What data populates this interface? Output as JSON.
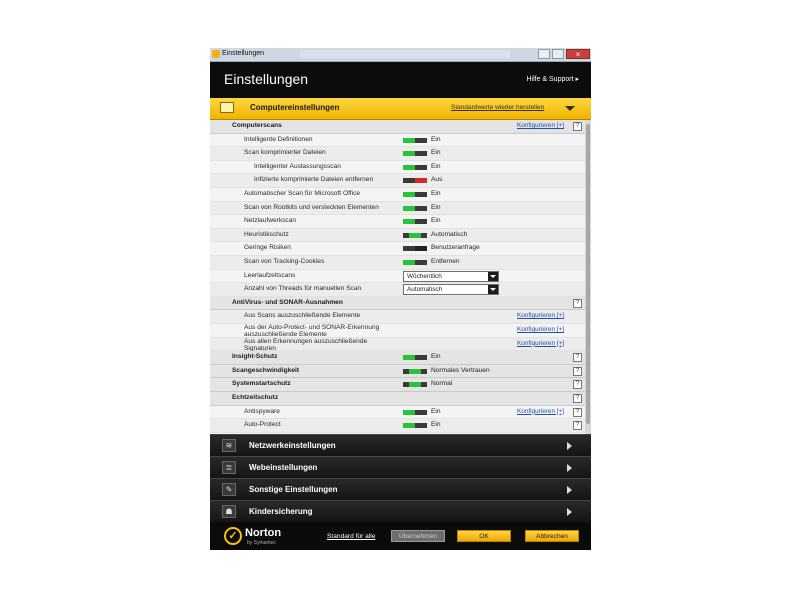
{
  "window": {
    "title": "Einstellungen",
    "header_title": "Einstellungen",
    "help_link": "Hilfe & Support ▸"
  },
  "category": {
    "title": "Computereinstellungen",
    "reset_link": "Standardwerte wieder herstellen"
  },
  "rows": [
    {
      "type": "section",
      "label": "Computerscans",
      "indent": 22,
      "cfg": "Konfigurieren [+]",
      "help": "?"
    },
    {
      "type": "toggle",
      "label": "Intelligente Definitionen",
      "indent": 34,
      "state": "on",
      "value": "Ein"
    },
    {
      "type": "toggle",
      "label": "Scan komprimierter Dateien",
      "indent": 34,
      "state": "on",
      "value": "Ein"
    },
    {
      "type": "toggle",
      "label": "Intelligenter Auslassungsscan",
      "indent": 44,
      "state": "on",
      "value": "Ein"
    },
    {
      "type": "toggle",
      "label": "Infizierte komprimierte Dateien entfernen",
      "indent": 44,
      "state": "off",
      "value": "Aus"
    },
    {
      "type": "toggle",
      "label": "Automatischer Scan für Microsoft Office",
      "indent": 34,
      "state": "on",
      "value": "Ein"
    },
    {
      "type": "toggle",
      "label": "Scan von Rootkits und versteckten Elementen",
      "indent": 34,
      "state": "on",
      "value": "Ein"
    },
    {
      "type": "toggle",
      "label": "Netzlaufwerkscan",
      "indent": 34,
      "state": "on",
      "value": "Ein"
    },
    {
      "type": "toggle",
      "label": "Heuristikschutz",
      "indent": 34,
      "state": "mid",
      "value": "Automatisch"
    },
    {
      "type": "toggle",
      "label": "Geringe Risiken",
      "indent": 34,
      "state": "dark",
      "value": "Benutzeranfrage"
    },
    {
      "type": "toggle",
      "label": "Scan von Tracking-Cookies",
      "indent": 34,
      "state": "on",
      "value": "Entfernen"
    },
    {
      "type": "select",
      "label": "Leerlaufzeitscans",
      "indent": 34,
      "value": "Wöchentlich"
    },
    {
      "type": "select",
      "label": "Anzahl von Threads für manuellen Scan",
      "indent": 34,
      "value": "Automatisch"
    },
    {
      "type": "section",
      "label": "AntiVirus- und SONAR-Ausnahmen",
      "indent": 22,
      "help": "?"
    },
    {
      "type": "link",
      "label": "Aus Scans auszuschließende Elemente",
      "indent": 34,
      "cfg": "Konfigurieren [+]"
    },
    {
      "type": "link2",
      "label": "Aus der Auto-Protect- und SONAR-Erkennung",
      "label2": "auszuschließende Elemente",
      "indent": 34,
      "cfg": "Konfigurieren [+]"
    },
    {
      "type": "link2",
      "label": "Aus allen Erkennungen auszuschließende",
      "label2": "Signaturen",
      "indent": 34,
      "cfg": "Konfigurieren [+]"
    },
    {
      "type": "section",
      "label": "Insight-Schutz",
      "indent": 22,
      "state": "on",
      "value": "Ein",
      "help": "?"
    },
    {
      "type": "section",
      "label": "Scangeschwindigkeit",
      "indent": 22,
      "state": "mid",
      "value": "Normales Vertrauen",
      "help": "?"
    },
    {
      "type": "section",
      "label": "Systemstartschutz",
      "indent": 22,
      "state": "mid",
      "value": "Normal",
      "help": "?"
    },
    {
      "type": "section",
      "label": "Echtzeitschutz",
      "indent": 22,
      "help": "?"
    },
    {
      "type": "toggle",
      "label": "Antispyware",
      "indent": 34,
      "state": "on",
      "value": "Ein",
      "cfg": "Konfigurieren [+]",
      "help": "?"
    },
    {
      "type": "toggle",
      "label": "Auto-Protect",
      "indent": 34,
      "state": "on",
      "value": "Ein",
      "help": "?"
    }
  ],
  "nav": [
    {
      "label": "Netzwerkeinstellungen",
      "icon": "wifi-icon",
      "glyph": "≋"
    },
    {
      "label": "Webeinstellungen",
      "icon": "web-list-icon",
      "glyph": "≣"
    },
    {
      "label": "Sonstige Einstellungen",
      "icon": "wrench-icon",
      "glyph": "✎"
    },
    {
      "label": "Kindersicherung",
      "icon": "family-icon",
      "glyph": "☗"
    }
  ],
  "footer": {
    "logo_name": "Norton",
    "logo_sub": "by Symantec",
    "standard_link": "Standard für alle",
    "apply": "Übernehmen",
    "ok": "OK",
    "cancel": "Abbrechen"
  },
  "colors": {
    "accent_yellow": "#f6c11b",
    "toggle_on": "#29c339",
    "toggle_off": "#d8262a",
    "link_blue": "#1f4fa8"
  }
}
